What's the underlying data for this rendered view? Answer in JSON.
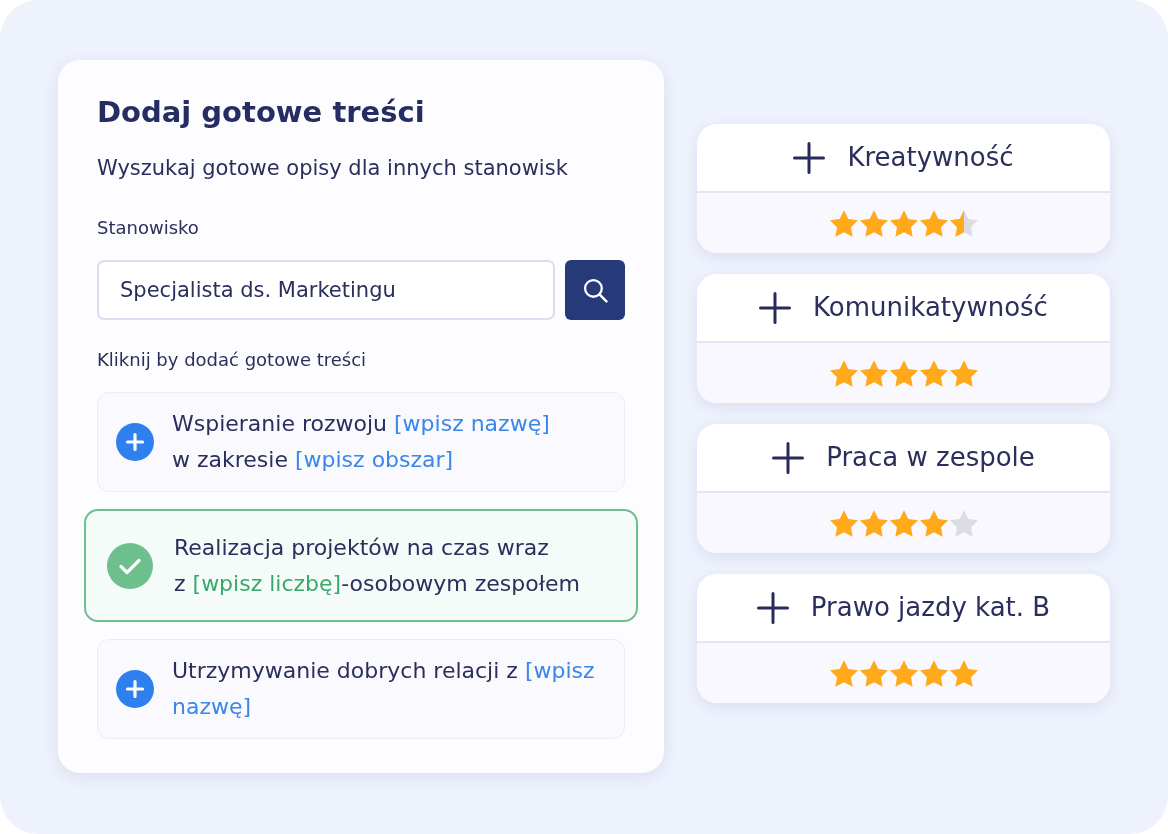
{
  "panel": {
    "title": "Dodaj gotowe treści",
    "subtitle": "Wyszukaj gotowe opisy dla innych stanowisk",
    "field": {
      "label": "Stanowisko",
      "value": "Specjalista ds. Marketingu"
    },
    "hint": "Kliknij by dodać gotowe treści",
    "suggestions": [
      {
        "selected": false,
        "lines": [
          [
            {
              "kind": "text",
              "text": "Wspieranie rozwoju "
            },
            {
              "kind": "placeholder",
              "text": "[wpisz nazwę]"
            }
          ],
          [
            {
              "kind": "text",
              "text": "w zakresie "
            },
            {
              "kind": "placeholder",
              "text": "[wpisz obszar]"
            }
          ]
        ]
      },
      {
        "selected": true,
        "lines": [
          [
            {
              "kind": "text",
              "text": "Realizacja projektów na czas wraz"
            }
          ],
          [
            {
              "kind": "text",
              "text": "z "
            },
            {
              "kind": "placeholder",
              "text": "[wpisz liczbę]"
            },
            {
              "kind": "text",
              "text": "-osobowym zespołem"
            }
          ]
        ]
      },
      {
        "selected": false,
        "lines": [
          [
            {
              "kind": "text",
              "text": "Utrzymywanie dobrych relacji z "
            },
            {
              "kind": "placeholder",
              "text": "[wpisz"
            }
          ],
          [
            {
              "kind": "placeholder",
              "text": "nazwę]"
            }
          ]
        ]
      }
    ]
  },
  "skills": [
    {
      "name": "Kreatywność",
      "stars": 4.5
    },
    {
      "name": "Komunikatywność",
      "stars": 5
    },
    {
      "name": "Praca w zespole",
      "stars": 4
    },
    {
      "name": "Prawo jazdy kat. B",
      "stars": 5
    }
  ]
}
